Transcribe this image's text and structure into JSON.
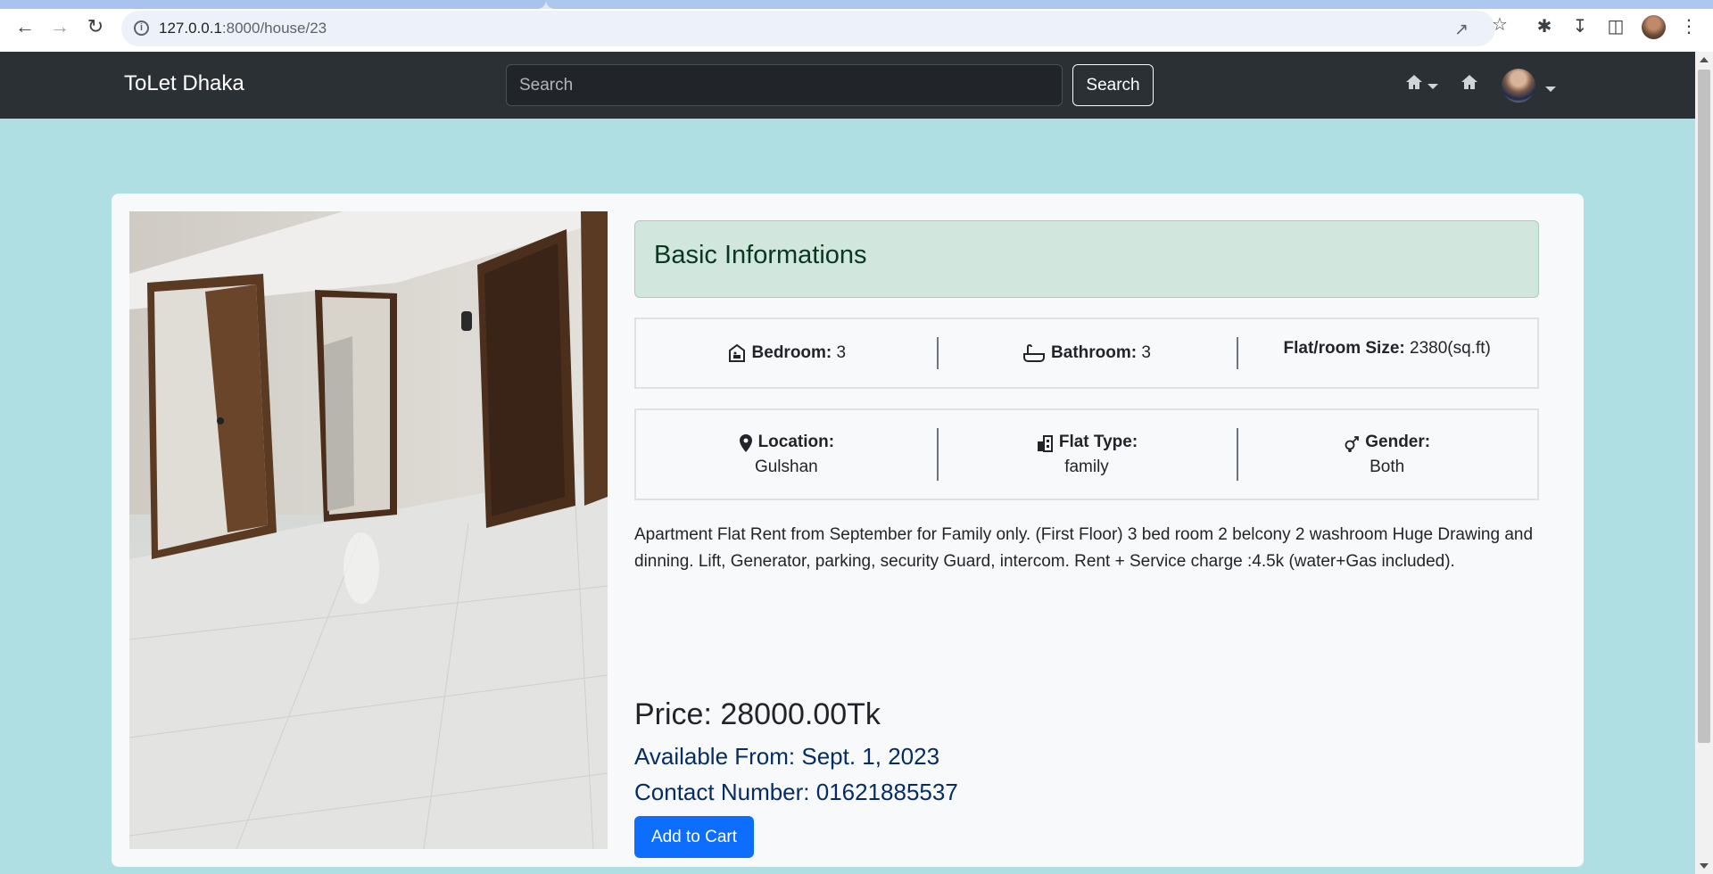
{
  "browser": {
    "url_host": "127.0.0.1",
    "url_path": ":8000/house/23"
  },
  "navbar": {
    "brand": "ToLet Dhaka",
    "search_placeholder": "Search",
    "search_button": "Search"
  },
  "house": {
    "section_title": "Basic Informations",
    "bedroom_label": "Bedroom:",
    "bedroom_value": "3",
    "bathroom_label": "Bathroom:",
    "bathroom_value": "3",
    "size_label": "Flat/room Size:",
    "size_value": "2380(sq.ft)",
    "location_label": "Location:",
    "location_value": "Gulshan",
    "flat_type_label": "Flat Type:",
    "flat_type_value": "family",
    "gender_label": "Gender:",
    "gender_value": "Both",
    "description": "Apartment Flat Rent from September for Family only. (First Floor) 3 bed room 2 belcony 2 washroom Huge Drawing and dinning. Lift, Generator, parking, security Guard, intercom. Rent + Service charge :4.5k (water+Gas included).",
    "price": "Price: 28000.00Tk",
    "available_from": "Available From: Sept. 1, 2023",
    "contact": "Contact Number: 01621885537",
    "add_to_cart": "Add to Cart"
  },
  "colors": {
    "page_bg": "#b0dfe3",
    "navbar_bg": "#2b3035",
    "alert_bg": "#d1e7dd",
    "primary": "#0d6efd"
  }
}
